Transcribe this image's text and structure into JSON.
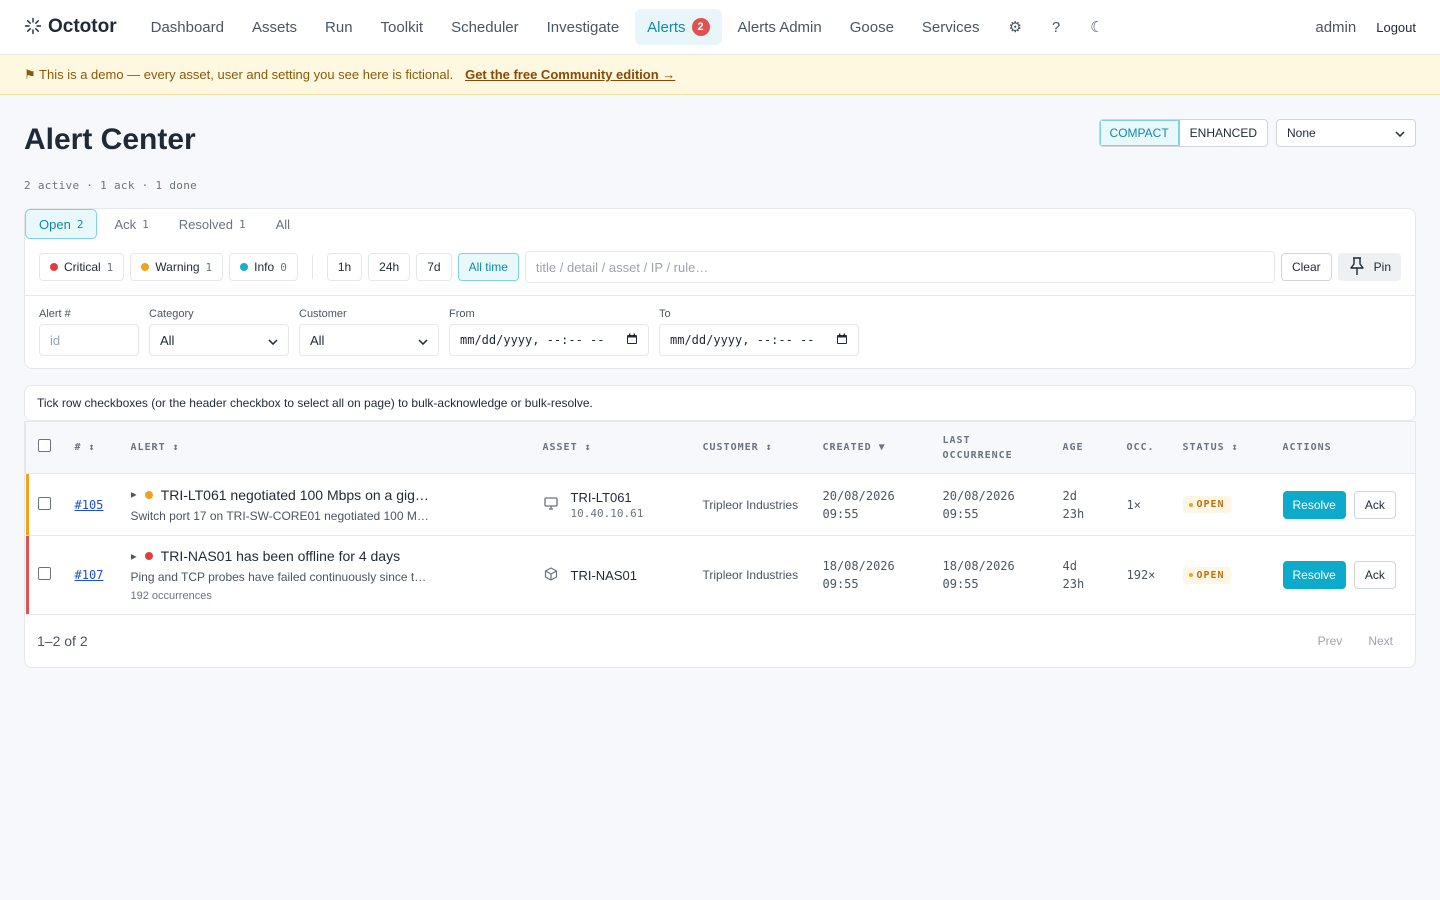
{
  "brand": {
    "name": "Octotor",
    "icon": "octopus-logo-icon"
  },
  "nav": {
    "items": [
      {
        "label": "Dashboard"
      },
      {
        "label": "Assets"
      },
      {
        "label": "Run"
      },
      {
        "label": "Toolkit"
      },
      {
        "label": "Scheduler"
      },
      {
        "label": "Investigate"
      },
      {
        "label": "Alerts",
        "badge": "2",
        "active": true
      },
      {
        "label": "Alerts Admin"
      },
      {
        "label": "Goose"
      },
      {
        "label": "Services"
      }
    ],
    "icons": {
      "settings": "⚙",
      "help": "?",
      "theme": "☾"
    },
    "user": "admin",
    "logout": "Logout"
  },
  "banner": {
    "text": "⚑ This is a demo — every asset, user and setting you see here is fictional.",
    "link": "Get the free Community edition →"
  },
  "page": {
    "title": "Alert Center",
    "subtitle": "2 active · 1 ack · 1 done",
    "view_modes": [
      "COMPACT",
      "ENHANCED"
    ],
    "active_view": "COMPACT",
    "group_by": "None"
  },
  "tabs": [
    {
      "label": "Open",
      "count": "2",
      "active": true
    },
    {
      "label": "Ack",
      "count": "1"
    },
    {
      "label": "Resolved",
      "count": "1"
    },
    {
      "label": "All",
      "count": ""
    }
  ],
  "severity": [
    {
      "label": "Critical",
      "count": "1",
      "color": "#e03e3e"
    },
    {
      "label": "Warning",
      "count": "1",
      "color": "#f0a31b"
    },
    {
      "label": "Info",
      "count": "0",
      "color": "#17b0cf"
    }
  ],
  "time_ranges": [
    {
      "label": "1h"
    },
    {
      "label": "24h"
    },
    {
      "label": "7d"
    },
    {
      "label": "All time",
      "active": true
    }
  ],
  "search": {
    "placeholder": "title / detail / asset / IP / rule…"
  },
  "buttons": {
    "clear": "Clear",
    "pin": "Pin"
  },
  "fields": {
    "alert_no": {
      "label": "Alert #",
      "placeholder": "id"
    },
    "category": {
      "label": "Category",
      "value": "All"
    },
    "customer": {
      "label": "Customer",
      "value": "All"
    },
    "from": {
      "label": "From",
      "value": "mm/dd/yyyy, --:-- --"
    },
    "to": {
      "label": "To",
      "value": "mm/dd/yyyy, --:-- --"
    }
  },
  "hint": "Tick row checkboxes (or the header checkbox to select all on page) to bulk-acknowledge or bulk-resolve.",
  "table": {
    "headers": {
      "id": "# ↕",
      "alert": "ALERT ↕",
      "asset": "ASSET ↕",
      "customer": "CUSTOMER ↕",
      "created": "CREATED ▼",
      "last": "LAST OCCURRENCE",
      "age": "AGE",
      "occ": "OCC.",
      "status": "STATUS ↕",
      "actions": "ACTIONS"
    },
    "rows": [
      {
        "id": "#105",
        "severity_color": "#f0a31b",
        "title": "TRI-LT061 negotiated 100 Mbps on a gig…",
        "detail": "Switch port 17 on TRI-SW-CORE01 negotiated 100 M…",
        "occurrences_note": "",
        "asset_icon": "monitor-icon",
        "asset": "TRI-LT061",
        "ip": "10.40.10.61",
        "customer": "Tripleor Industries",
        "created_date": "20/08/2026",
        "created_time": "09:55",
        "last_date": "20/08/2026",
        "last_time": "09:55",
        "age_a": "2d",
        "age_b": "23h",
        "occ": "1×",
        "status": "OPEN",
        "resolve": "Resolve",
        "ack": "Ack"
      },
      {
        "id": "#107",
        "severity_color": "#e03e3e",
        "title": "TRI-NAS01 has been offline for 4 days",
        "detail": "Ping and TCP probes have failed continuously since t…",
        "occurrences_note": "192 occurrences",
        "asset_icon": "box-icon",
        "asset": "TRI-NAS01",
        "ip": "",
        "customer": "Tripleor Industries",
        "created_date": "18/08/2026",
        "created_time": "09:55",
        "last_date": "18/08/2026",
        "last_time": "09:55",
        "age_a": "4d",
        "age_b": "23h",
        "occ": "192×",
        "status": "OPEN",
        "resolve": "Resolve",
        "ack": "Ack"
      }
    ]
  },
  "pager": {
    "info": "1–2 of 2",
    "prev": "Prev",
    "next": "Next"
  }
}
